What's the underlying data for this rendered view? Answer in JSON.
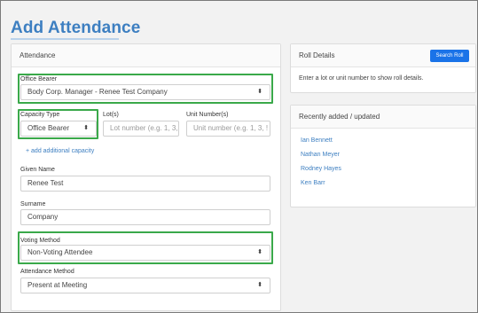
{
  "page": {
    "title": "Add Attendance"
  },
  "attendance_panel": {
    "heading": "Attendance",
    "office_bearer": {
      "label": "Office Bearer",
      "value": "Body Corp. Manager - Renee Test Company"
    },
    "capacity_type": {
      "label": "Capacity Type",
      "value": "Office Bearer"
    },
    "lots": {
      "label": "Lot(s)",
      "placeholder": "Lot number (e.g. 1, 3,"
    },
    "unit_numbers": {
      "label": "Unit Number(s)",
      "placeholder": "Unit number (e.g. 1, 3, !"
    },
    "add_capacity_link": "+ add additional capacity",
    "given_name": {
      "label": "Given Name",
      "value": "Renee Test"
    },
    "surname": {
      "label": "Surname",
      "value": "Company"
    },
    "voting_method": {
      "label": "Voting Method",
      "value": "Non-Voting Attendee"
    },
    "attendance_method": {
      "label": "Attendance Method",
      "value": "Present at Meeting"
    }
  },
  "roll_panel": {
    "heading": "Roll Details",
    "search_button": "Search Roll",
    "message": "Enter a lot or unit number to show roll details."
  },
  "recent_panel": {
    "heading": "Recently added / updated",
    "items": [
      "Ian Bennett",
      "Nathan Meyer",
      "Rodney Hayes",
      "Ken Barr"
    ]
  },
  "icons": {
    "select_caret": "updown-caret-icon"
  },
  "colors": {
    "accent": "#3d7fc1",
    "highlight": "#3aa94a",
    "button": "#1a73e8"
  }
}
